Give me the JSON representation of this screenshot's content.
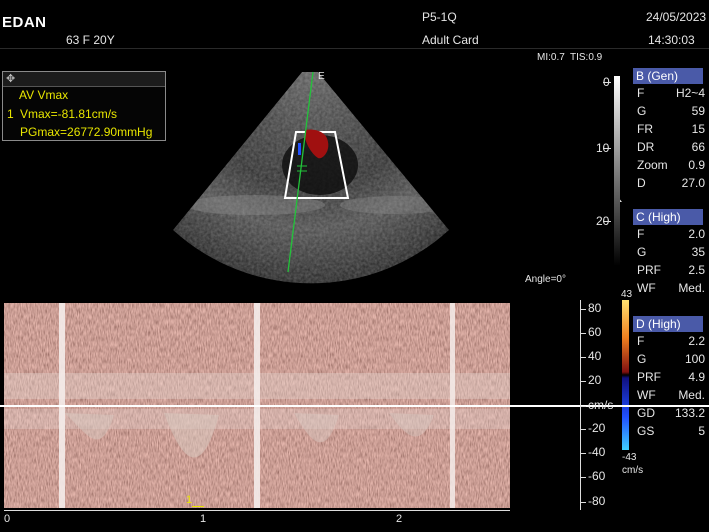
{
  "header": {
    "brand": "EDAN",
    "patient_info": "63   F   20Y",
    "probe": "P5-1Q",
    "preset": "Adult Card",
    "date": "24/05/2023",
    "time": "14:30:03",
    "mi": "MI:0.7",
    "tis": "TIS:0.9"
  },
  "measurement": {
    "title": "AV Vmax",
    "index": "1",
    "vmax": "Vmax=-81.81cm/s",
    "pgmax": "PGmax=26772.90mmHg"
  },
  "image": {
    "sector_marker": "E",
    "angle_label": "Angle=0°",
    "depth_ticks": [
      "0",
      "10",
      "20"
    ]
  },
  "b_mode": {
    "title": "B (Gen)",
    "params": [
      {
        "label": "F",
        "value": "H2~4"
      },
      {
        "label": "G",
        "value": "59"
      },
      {
        "label": "FR",
        "value": "15"
      },
      {
        "label": "DR",
        "value": "66"
      },
      {
        "label": "Zoom",
        "value": "0.9"
      },
      {
        "label": "D",
        "value": "27.0"
      }
    ]
  },
  "c_mode": {
    "title": "C (High)",
    "params": [
      {
        "label": "F",
        "value": "2.0"
      },
      {
        "label": "G",
        "value": "35"
      },
      {
        "label": "PRF",
        "value": "2.5"
      },
      {
        "label": "WF",
        "value": "Med."
      }
    ]
  },
  "d_mode": {
    "title": "D (High)",
    "params": [
      {
        "label": "F",
        "value": "2.2"
      },
      {
        "label": "G",
        "value": "100"
      },
      {
        "label": "PRF",
        "value": "4.9"
      },
      {
        "label": "WF",
        "value": "Med."
      },
      {
        "label": "GD",
        "value": "133.2"
      },
      {
        "label": "GS",
        "value": "5"
      }
    ]
  },
  "color_scale": {
    "top": "43",
    "bottom": "-43",
    "unit": "cm/s"
  },
  "doppler": {
    "velocity_ticks": [
      "80",
      "60",
      "40",
      "20",
      "cm/s",
      "-20",
      "-40",
      "-60",
      "-80"
    ],
    "time_ticks": [
      "0",
      "1",
      "2"
    ],
    "cursor_label": "1"
  },
  "colors": {
    "param_header": "#4a5aa8",
    "measure_text": "#e8e600",
    "centerline": "#22c33a"
  }
}
